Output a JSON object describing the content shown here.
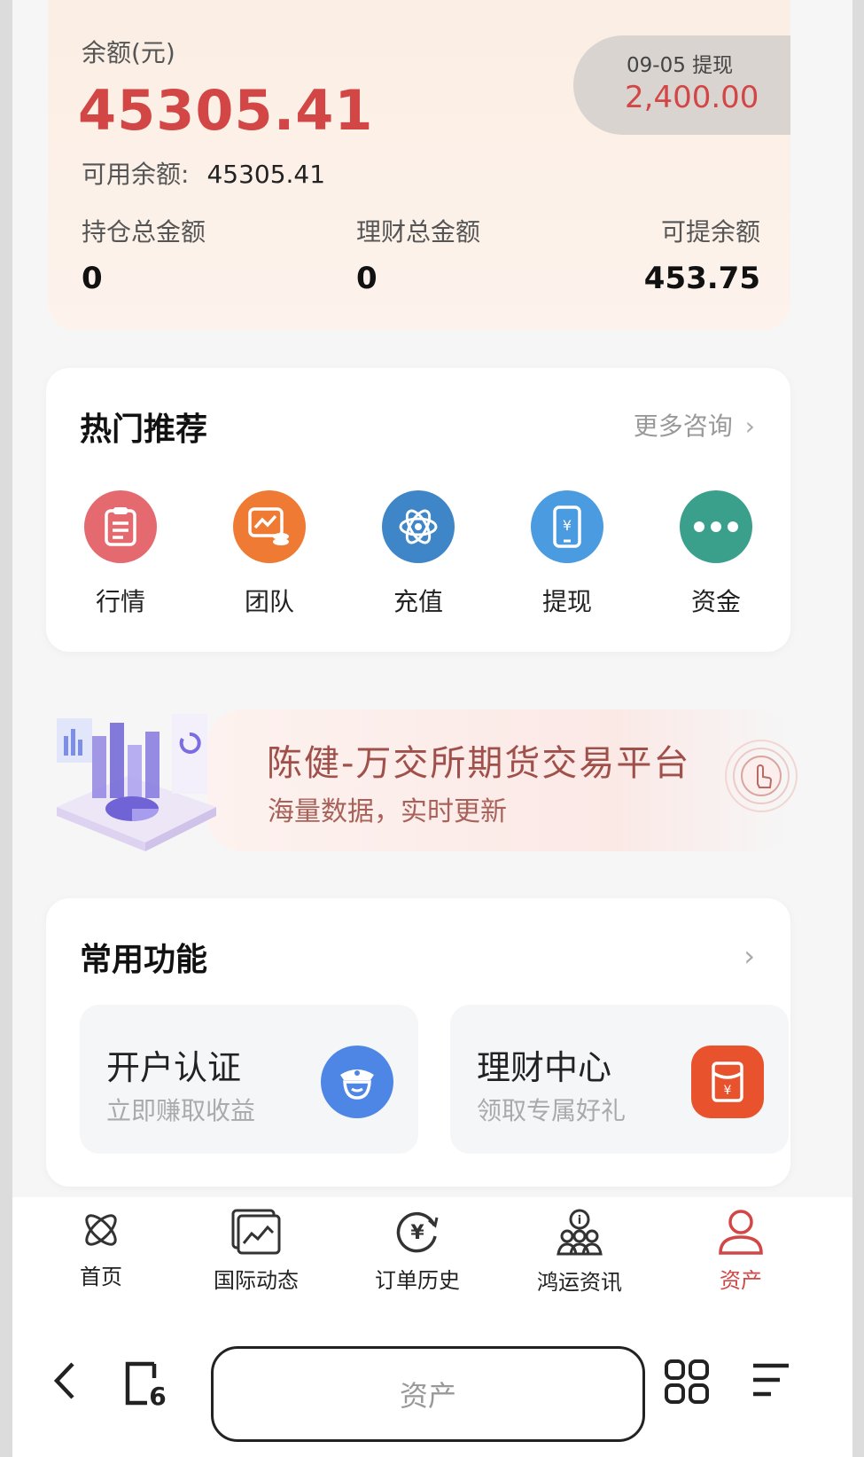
{
  "balance": {
    "label": "余额(元)",
    "value": "45305.41",
    "available_label": "可用余额:",
    "available_value": "45305.41",
    "withdraw_date": "09-05 提现",
    "withdraw_amount": "2,400.00",
    "stats": [
      {
        "label": "持仓总金额",
        "value": "0"
      },
      {
        "label": "理财总金额",
        "value": "0"
      },
      {
        "label": "可提余额",
        "value": "453.75"
      }
    ]
  },
  "hot": {
    "title": "热门推荐",
    "more": "更多咨询",
    "items": [
      {
        "label": "行情",
        "icon": "clipboard-icon",
        "color": "#e46a6f"
      },
      {
        "label": "团队",
        "icon": "chart-coins-icon",
        "color": "#ee7a33"
      },
      {
        "label": "充值",
        "icon": "atom-icon",
        "color": "#3f86c8"
      },
      {
        "label": "提现",
        "icon": "phone-yuan-icon",
        "color": "#4a9be0"
      },
      {
        "label": "资金",
        "icon": "more-dots-icon",
        "color": "#3aa08c"
      }
    ]
  },
  "banner": {
    "title": "陈健-万交所期货交易平台",
    "subtitle": "海量数据，实时更新"
  },
  "common": {
    "title": "常用功能",
    "features": [
      {
        "title": "开户认证",
        "subtitle": "立即赚取收益",
        "icon": "officer-icon",
        "color": "#4e86e6"
      },
      {
        "title": "理财中心",
        "subtitle": "领取专属好礼",
        "icon": "red-envelope-icon",
        "color": "#e8522c"
      }
    ]
  },
  "tabbar": {
    "items": [
      {
        "label": "首页",
        "icon": "atom-outline-icon"
      },
      {
        "label": "国际动态",
        "icon": "chart-window-icon"
      },
      {
        "label": "订单历史",
        "icon": "yuan-refresh-icon"
      },
      {
        "label": "鸿运资讯",
        "icon": "people-info-icon"
      },
      {
        "label": "资产",
        "icon": "user-icon",
        "active": true
      }
    ],
    "active_color": "#d24646"
  },
  "browser": {
    "address_text": "资产",
    "tab_count": "6"
  }
}
